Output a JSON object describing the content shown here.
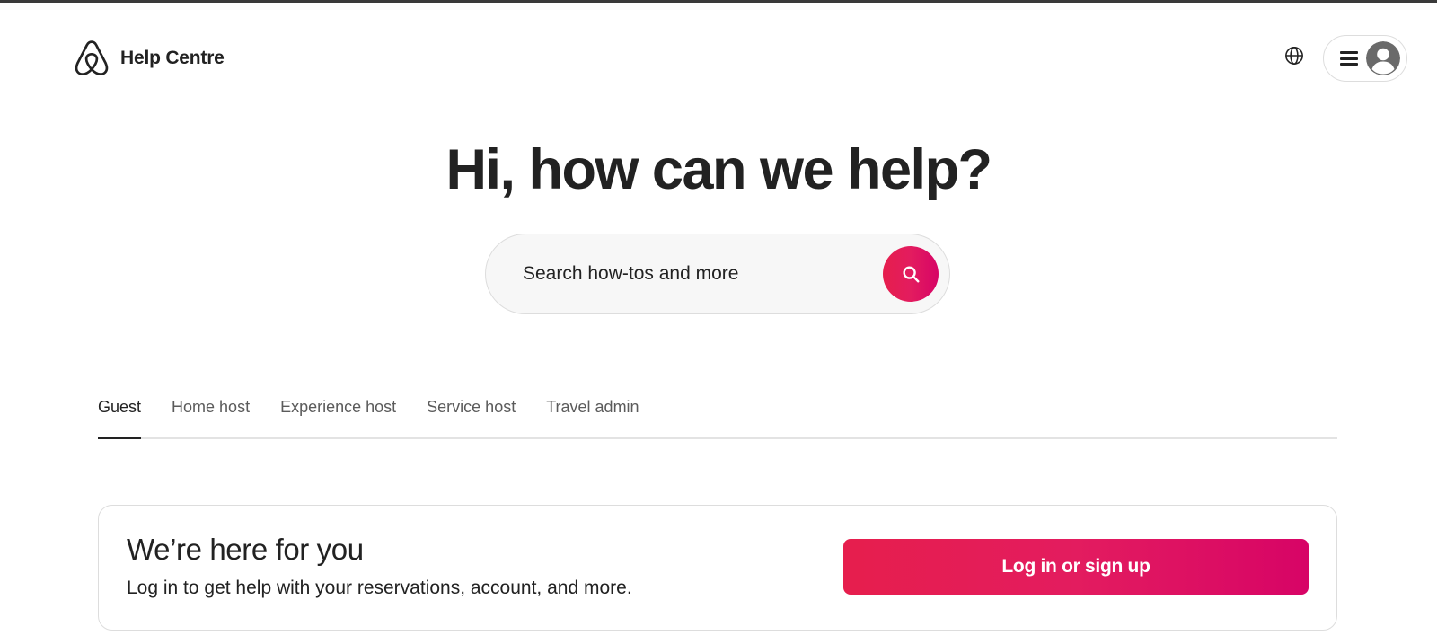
{
  "header": {
    "brand_label": "Help Centre",
    "logo_icon": "airbnb-belo-icon",
    "language_icon": "globe-icon",
    "menu_icon": "hamburger-menu-icon",
    "avatar_icon": "user-avatar-icon"
  },
  "hero": {
    "title": "Hi, how can we help?",
    "search_placeholder": "Search how-tos and more",
    "search_icon": "search-icon"
  },
  "tabs": [
    {
      "label": "Guest",
      "active": true
    },
    {
      "label": "Home host",
      "active": false
    },
    {
      "label": "Experience host",
      "active": false
    },
    {
      "label": "Service host",
      "active": false
    },
    {
      "label": "Travel admin",
      "active": false
    }
  ],
  "card": {
    "title": "We’re here for you",
    "subtitle": "Log in to get help with your reservations, account, and more.",
    "button_label": "Log in or sign up"
  },
  "colors": {
    "brand_primary": "#E61E4D",
    "brand_gradient_end": "#D70466",
    "text_primary": "#222222",
    "text_secondary": "#5B5B5B",
    "border": "#DDDDDD",
    "search_background": "#F7F7F7"
  }
}
